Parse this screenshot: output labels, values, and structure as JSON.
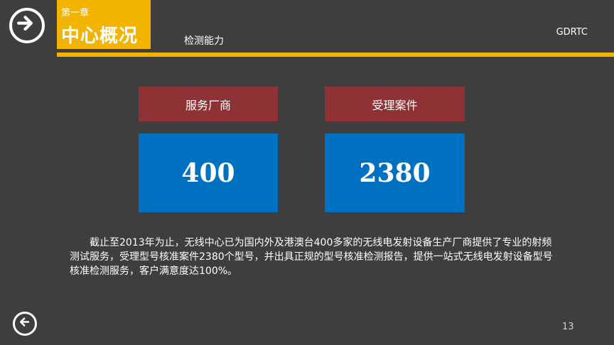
{
  "header": {
    "chapter_sub": "第一章",
    "chapter_title": "中心概况",
    "section": "检测能力",
    "org": "GDRTC"
  },
  "cards": [
    {
      "label": "服务厂商",
      "value": "400"
    },
    {
      "label": "受理案件",
      "value": "2380"
    }
  ],
  "body_text": "截止至2013年为止，无线中心已为国内外及港澳台400多家的无线电发射设备生产厂商提供了专业的射频测试服务，受理型号核准案件2380个型号，并出具正规的型号核准检测报告，提供一站式无线电发射设备型号核准检测服务，客户满意度达100%。",
  "footer": {
    "page_number": "13"
  },
  "icons": {
    "next": "arrow-right-circle-icon",
    "back": "arrow-left-circle-icon"
  },
  "colors": {
    "accent": "#f2b400",
    "card_head": "#8f3236",
    "card_value": "#0070c0",
    "background": "#3e3e3e"
  }
}
